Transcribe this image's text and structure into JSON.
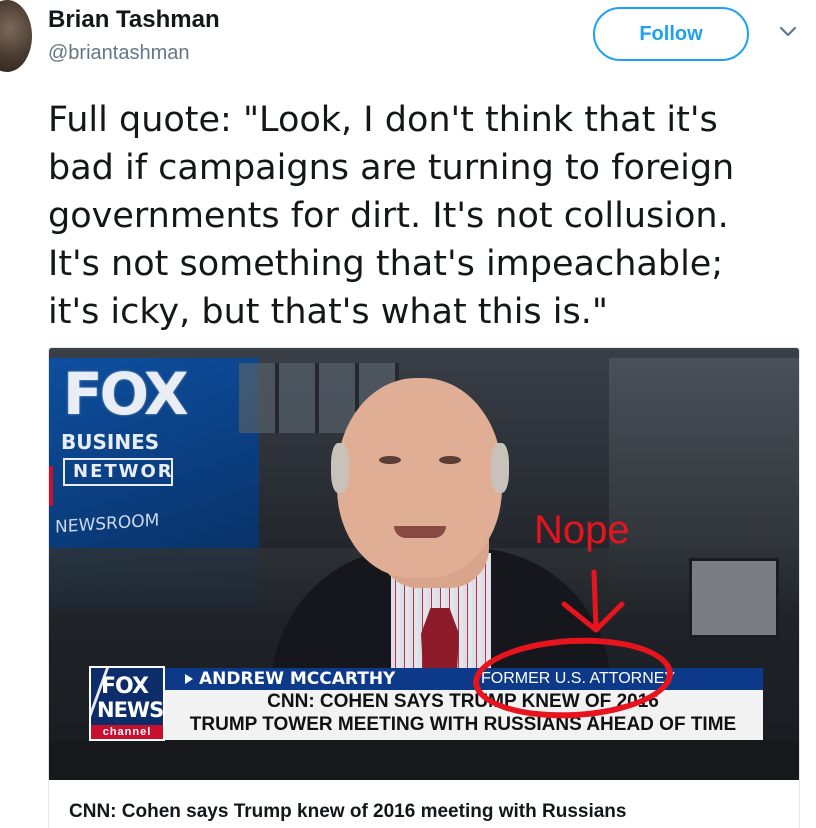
{
  "tweet": {
    "author_name": "Brian Tashman",
    "author_handle": "@briantashman",
    "follow_label": "Follow",
    "text_lines": [
      "Full quote: \"Look, I don't think that it's",
      "bad if campaigns are turning to foreign",
      "governments for dirt. It's not collusion.",
      "It's not something that's impeachable;",
      "it's icky, but that's what this is.\""
    ]
  },
  "card": {
    "title": "CNN: Cohen says Trump knew of 2016 meeting with Russians",
    "image": {
      "background_logo": {
        "fox": "FOX",
        "business": "BUSINES",
        "network": "NETWOR",
        "newsroom": "NEWSROOM"
      },
      "annotation": "Nope",
      "chyron": {
        "logo_fox": "FOX",
        "logo_news": "NEWS",
        "logo_channel": "channel",
        "name": "ANDREW MCCARTHY",
        "title": "FORMER U.S. ATTORNEY",
        "headline_1": "CNN: COHEN SAYS TRUMP KNEW OF 2016",
        "headline_2": "TRUMP TOWER MEETING WITH RUSSIANS AHEAD OF TIME"
      }
    }
  },
  "colors": {
    "accent": "#1da1f2",
    "annotation_red": "#e8141d",
    "chyron_blue": "#0d3a88"
  }
}
